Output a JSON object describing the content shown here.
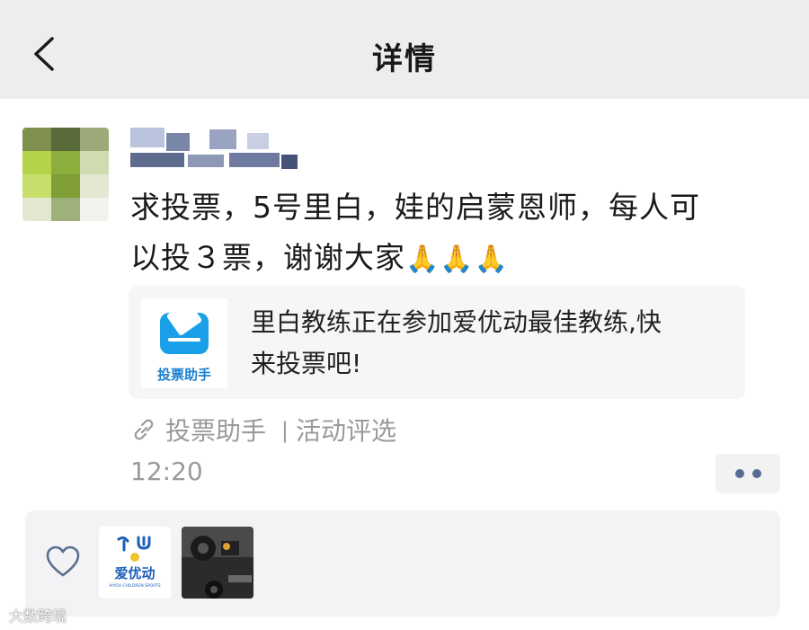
{
  "header": {
    "title": "详情"
  },
  "post": {
    "text_line1": "求投票，5号里白，娃的启蒙恩师，每人可",
    "text_line2": "以投３票，谢谢大家",
    "emojis": [
      "🙏",
      "🙏",
      "🙏"
    ],
    "time": "12:20"
  },
  "card": {
    "icon_label": "投票助手",
    "text_line1": "里白教练正在参加爱优动最佳教练,快",
    "text_line2": "来投票吧!"
  },
  "source": {
    "app": "投票助手",
    "separator": "|",
    "category": "活动评选"
  },
  "likes": {
    "avatar1_label": "爱优动",
    "avatar1_sub": "AIYOU CHILDREN SPORTS"
  },
  "watermark": {
    "text": "大数跨境"
  },
  "colors": {
    "header_bg": "#ededed",
    "link_blue": "#566b93",
    "card_bg": "#f6f6f6",
    "meta_gray": "#9a9a9a",
    "vote_icon_blue": "#1aa0e8"
  }
}
